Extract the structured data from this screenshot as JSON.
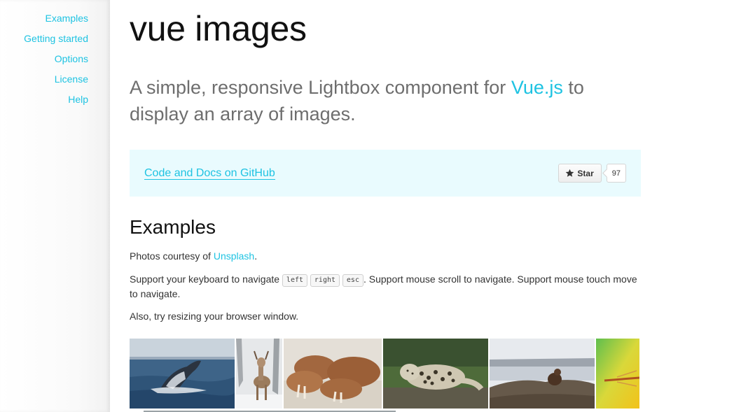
{
  "sidebar": {
    "items": [
      {
        "label": "Examples"
      },
      {
        "label": "Getting started"
      },
      {
        "label": "Options"
      },
      {
        "label": "License"
      },
      {
        "label": "Help"
      }
    ]
  },
  "header": {
    "title": "vue images",
    "lead_prefix": "A simple, responsive Lightbox component for ",
    "lead_link": "Vue.js",
    "lead_suffix": " to display an array of images."
  },
  "github": {
    "link_label": "Code and Docs on GitHub",
    "star_label": "Star",
    "star_count": "97"
  },
  "examples": {
    "heading": "Examples",
    "credit_prefix": "Photos courtesy of ",
    "credit_link": "Unsplash",
    "credit_suffix": ".",
    "keys_prefix": "Support your keyboard to navigate ",
    "keys": [
      "left",
      "right",
      "esc"
    ],
    "keys_suffix": ". Support mouse scroll to navigate. Support mouse touch move to navigate.",
    "resize_hint": "Also, try resizing your browser window."
  },
  "gallery": {
    "images": [
      {
        "subject": "whale",
        "icon": "whale-photo"
      },
      {
        "subject": "deer",
        "icon": "deer-photo"
      },
      {
        "subject": "walrus",
        "icon": "walrus-photo"
      },
      {
        "subject": "leopard",
        "icon": "leopard-photo"
      },
      {
        "subject": "beaver",
        "icon": "beaver-photo"
      },
      {
        "subject": "dragonfly",
        "icon": "dragonfly-photo"
      }
    ]
  },
  "colors": {
    "accent": "#1ec3e2",
    "callout_bg": "#e9fbfe"
  }
}
